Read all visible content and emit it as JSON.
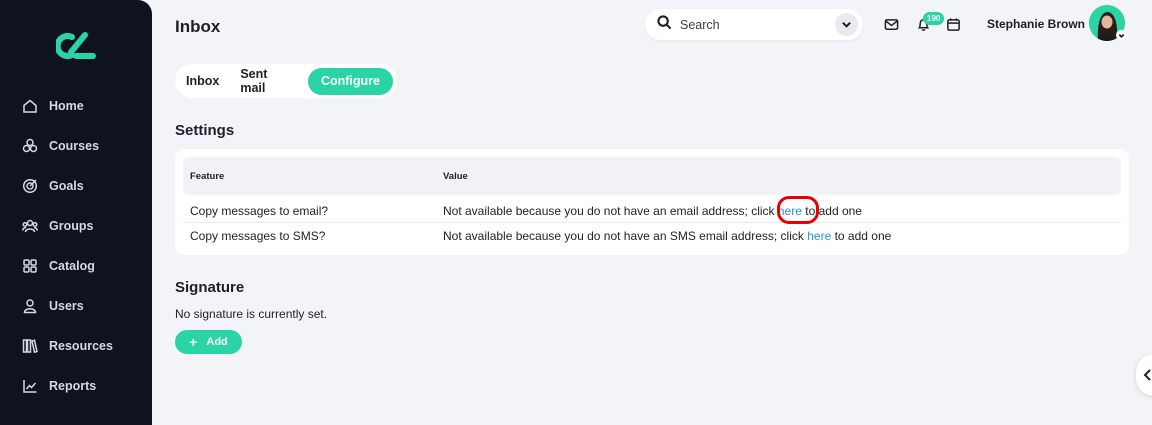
{
  "header": {
    "title": "Inbox",
    "search_placeholder": "Search",
    "notification_count": "190",
    "user_name": "Stephanie Brown"
  },
  "sidebar": {
    "items": [
      {
        "label": "Home",
        "icon": "home-icon"
      },
      {
        "label": "Courses",
        "icon": "courses-icon"
      },
      {
        "label": "Goals",
        "icon": "goals-icon"
      },
      {
        "label": "Groups",
        "icon": "groups-icon"
      },
      {
        "label": "Catalog",
        "icon": "catalog-icon"
      },
      {
        "label": "Users",
        "icon": "user-icon"
      },
      {
        "label": "Resources",
        "icon": "resources-icon"
      },
      {
        "label": "Reports",
        "icon": "reports-icon"
      }
    ]
  },
  "tabs": [
    "Inbox",
    "Sent mail",
    "Configure"
  ],
  "settings": {
    "title": "Settings",
    "columns": [
      "Feature",
      "Value"
    ],
    "rows": [
      {
        "feature": "Copy messages to email?",
        "value_prefix": "Not available because you do not have an email address; click",
        "link": "here",
        "value_suffix": "to add one"
      },
      {
        "feature": "Copy messages to SMS?",
        "value_prefix": "Not available because you do not have an SMS email address; click",
        "link": "here",
        "value_suffix": "to add one"
      }
    ]
  },
  "signature": {
    "title": "Signature",
    "text": "No signature is currently set.",
    "add_label": "Add"
  },
  "colors": {
    "accent": "#2bd4a4",
    "sidebar_bg": "#0f1320",
    "link": "#2a93d5",
    "highlight": "#e60000"
  }
}
